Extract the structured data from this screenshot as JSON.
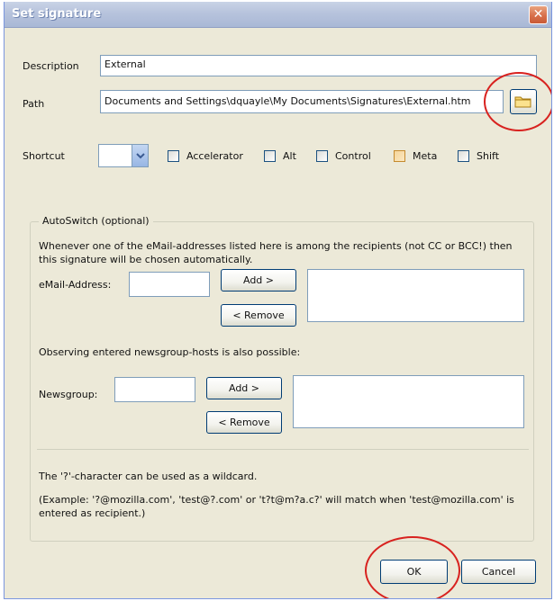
{
  "window": {
    "title": "Set signature",
    "close_symbol": "✕"
  },
  "description": {
    "label": "Description",
    "value": "External"
  },
  "path": {
    "label": "Path",
    "value": "Documents and Settings\\dquayle\\My Documents\\Signatures\\External.htm"
  },
  "shortcut": {
    "label": "Shortcut",
    "value": "",
    "dropdown_icon": "chevron-down-icon",
    "modifiers": [
      {
        "label": "Accelerator",
        "checked": false
      },
      {
        "label": "Alt",
        "checked": false
      },
      {
        "label": "Control",
        "checked": false
      },
      {
        "label": "Meta",
        "checked": false
      },
      {
        "label": "Shift",
        "checked": false
      }
    ]
  },
  "autoswitch": {
    "legend": "AutoSwitch (optional)",
    "description": "Whenever one of the eMail-addresses listed here is among the recipients (not CC or BCC!) then this signature will be chosen automatically.",
    "email": {
      "label": "eMail-Address:",
      "value": "",
      "add_label": "Add >",
      "remove_label": "< Remove"
    },
    "newsgroup_intro": "Observing entered newsgroup-hosts is also possible:",
    "newsgroup": {
      "label": "Newsgroup:",
      "value": "",
      "add_label": "Add >",
      "remove_label": "< Remove"
    },
    "wildcard_note": "The '?'-character can be used as a wildcard.",
    "example": "(Example: '?@mozilla.com', 'test@?.com' or 't?t@m?a.c?' will match when 'test@mozilla.com' is entered as recipient.)"
  },
  "footer": {
    "ok_label": "OK",
    "cancel_label": "Cancel"
  },
  "colors": {
    "annotation_circle": "#d8221f",
    "title_bar": "#b7c3dc",
    "dialog_bg": "#ece9d8"
  }
}
